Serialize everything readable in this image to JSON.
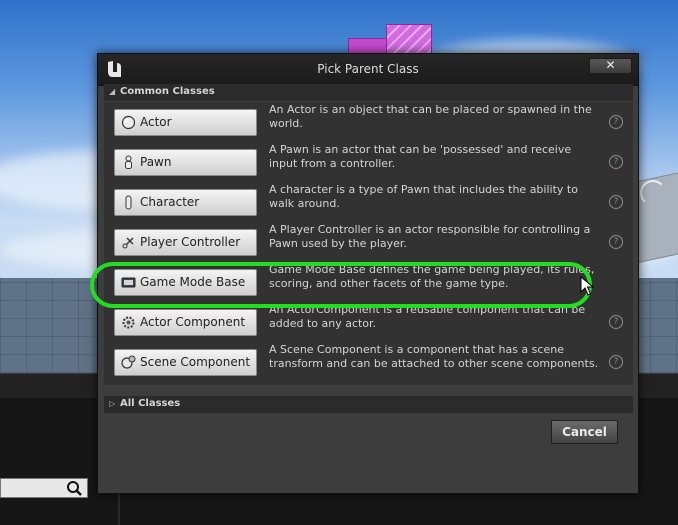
{
  "dialog": {
    "title": "Pick Parent Class",
    "close_label": "✕"
  },
  "sections": {
    "common": {
      "label": "Common Classes",
      "expanded": true
    },
    "all": {
      "label": "All Classes",
      "expanded": false
    }
  },
  "classes": [
    {
      "label": "Actor",
      "description": "An Actor is an object that can be placed or spawned in the world.",
      "icon": "actor-sphere-icon"
    },
    {
      "label": "Pawn",
      "description": "A Pawn is an actor that can be 'possessed' and receive input from a controller.",
      "icon": "pawn-figure-icon"
    },
    {
      "label": "Character",
      "description": "A character is a type of Pawn that includes the ability to walk around.",
      "icon": "character-capsule-icon"
    },
    {
      "label": "Player Controller",
      "description": "A Player Controller is an actor responsible for controlling a Pawn used by the player.",
      "icon": "controller-icon"
    },
    {
      "label": "Game Mode Base",
      "description": "Game Mode Base defines the game being played, its rules, scoring, and other facets of the game type.",
      "icon": "game-mode-icon"
    },
    {
      "label": "Actor Component",
      "description": "An ActorComponent is a reusable component that can be added to any actor.",
      "icon": "actor-component-icon"
    },
    {
      "label": "Scene Component",
      "description": "A Scene Component is a component that has a scene transform and can be attached to other scene components.",
      "icon": "scene-component-icon"
    }
  ],
  "footer": {
    "cancel_label": "Cancel"
  },
  "help_glyph": "?",
  "highlight": {
    "target": "Game Mode Base",
    "color": "#22dd22"
  }
}
